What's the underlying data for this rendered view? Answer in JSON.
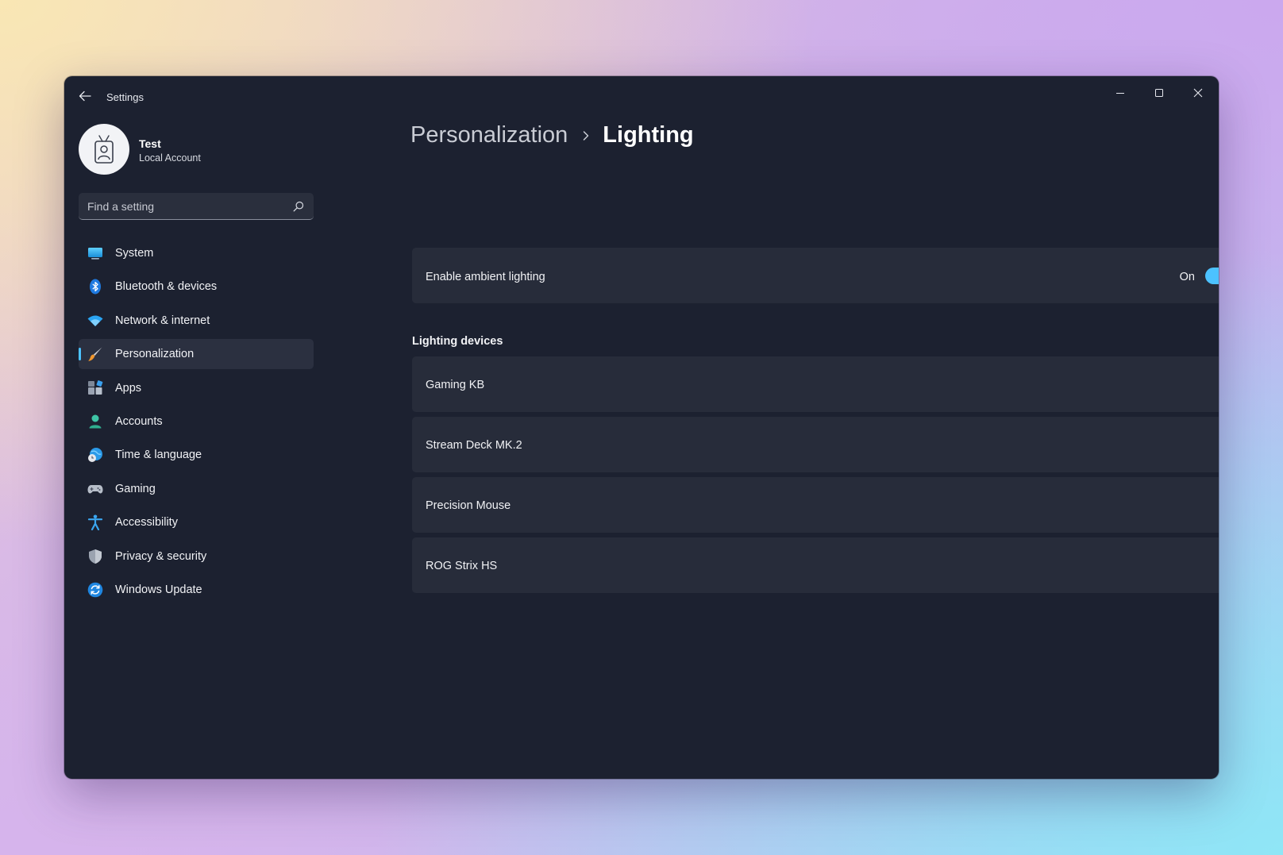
{
  "window": {
    "title": "Settings"
  },
  "user": {
    "name": "Test",
    "account_type": "Local Account"
  },
  "search": {
    "placeholder": "Find a setting"
  },
  "sidebar": {
    "items": [
      {
        "label": "System",
        "icon": "monitor-icon"
      },
      {
        "label": "Bluetooth & devices",
        "icon": "bluetooth-icon"
      },
      {
        "label": "Network & internet",
        "icon": "wifi-icon"
      },
      {
        "label": "Personalization",
        "icon": "paintbrush-icon",
        "active": true
      },
      {
        "label": "Apps",
        "icon": "apps-icon"
      },
      {
        "label": "Accounts",
        "icon": "person-icon"
      },
      {
        "label": "Time & language",
        "icon": "globe-clock-icon"
      },
      {
        "label": "Gaming",
        "icon": "gamepad-icon"
      },
      {
        "label": "Accessibility",
        "icon": "accessibility-icon"
      },
      {
        "label": "Privacy & security",
        "icon": "shield-icon"
      },
      {
        "label": "Windows Update",
        "icon": "update-icon"
      }
    ]
  },
  "breadcrumb": {
    "parent": "Personalization",
    "current": "Lighting"
  },
  "ambient": {
    "label": "Enable ambient lighting",
    "state_label": "On",
    "enabled": true
  },
  "devices": {
    "section_title": "Lighting devices",
    "items": [
      {
        "label": "Gaming KB"
      },
      {
        "label": "Stream Deck MK.2"
      },
      {
        "label": "Precision Mouse"
      },
      {
        "label": "ROG Strix HS"
      }
    ]
  },
  "colors": {
    "accent": "#4cc2ff",
    "window_bg": "#1c2130",
    "card_bg": "#272c3a"
  }
}
